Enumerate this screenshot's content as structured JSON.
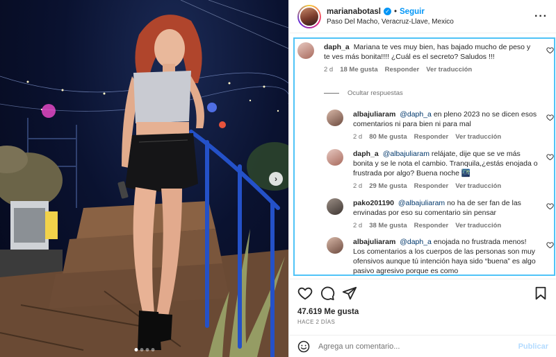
{
  "post": {
    "username": "marianabotasl",
    "follow_label": "Seguir",
    "location": "Paso Del Macho, Veracruz-Llave, Mexico",
    "likes": "47.619 Me gusta",
    "time_ago": "HACE 2 DÍAS",
    "add_comment_placeholder": "Agrega un comentario...",
    "publish_label": "Publicar",
    "bullet": "•",
    "more_label": "···"
  },
  "carousel": {
    "current_slide": 1,
    "total_slides": 4
  },
  "comments": [
    {
      "user": "daph_a",
      "mention": "",
      "text": "Mariana te ves muy bien, has bajado mucho de peso y te ves más bonita!!!! ¿Cuál es el secreto? Saludos !!!",
      "time": "2 d",
      "likes": "18 Me gusta",
      "reply": "Responder",
      "translate": "Ver traducción"
    },
    {
      "user": "albajuliaram",
      "mention": "@daph_a",
      "text": "en pleno 2023 no se dicen esos comentarios ni para bien ni para mal",
      "time": "2 d",
      "likes": "80 Me gusta",
      "reply": "Responder",
      "translate": "Ver traducción"
    },
    {
      "user": "daph_a",
      "mention": "@albajuliaram",
      "text": "relájate, dije que se ve más bonita y se le nota el cambio. Tranquila,¿estás enojada o frustrada por algo? Buena noche 🌃",
      "time": "2 d",
      "likes": "29 Me gusta",
      "reply": "Responder",
      "translate": "Ver traducción"
    },
    {
      "user": "pako201190",
      "mention": "@albajuliaram",
      "text": "no ha de ser fan de las envinadas por eso su comentario sin pensar",
      "time": "2 d",
      "likes": "38 Me gusta",
      "reply": "Responder",
      "translate": "Ver traducción"
    },
    {
      "user": "albajuliaram",
      "mention": "@daph_a",
      "text": "enojada no frustrada menos! Los comentarios a los cuerpos de las personas son muy ofensivos aunque tú intención haya sido “buena” es algo pasivo agresivo porque es como",
      "time": "",
      "likes": "",
      "reply": "",
      "translate": ""
    }
  ],
  "hide_replies_label": "Ocultar respuestas",
  "colors": {
    "accent": "#0095f6",
    "highlight_border": "#4fc3f7",
    "mention": "#00376b"
  },
  "icons": [
    "heart-icon",
    "comment-icon",
    "share-icon",
    "bookmark-icon",
    "emoji-icon",
    "verified-icon",
    "more-icon",
    "chevron-right-icon"
  ]
}
